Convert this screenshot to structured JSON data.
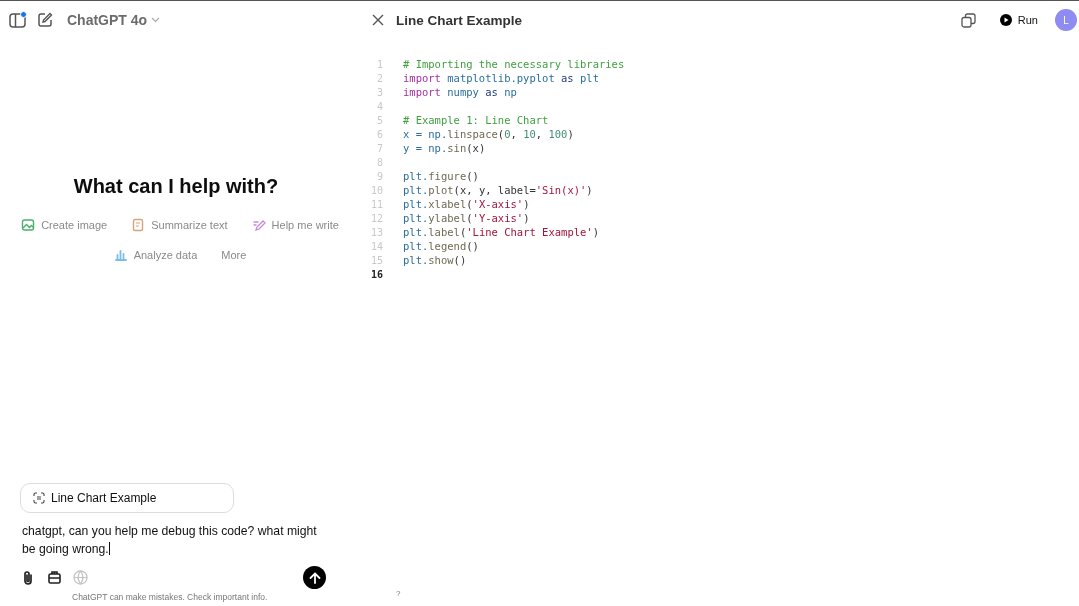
{
  "chat": {
    "model": "ChatGPT 4o",
    "sidebar_notification": true,
    "heading": "What can I help with?",
    "suggestion_rows": [
      [
        {
          "label": "Create image",
          "kind": "image",
          "color": "#4caf6a"
        },
        {
          "label": "Summarize text",
          "kind": "doc",
          "color": "#d9a27a"
        },
        {
          "label": "Help me write",
          "kind": "pen",
          "color": "#c58ad6"
        }
      ],
      [
        {
          "label": "Analyze data",
          "kind": "chart",
          "color": "#7cbde8"
        },
        {
          "label": "More",
          "kind": "none"
        }
      ]
    ],
    "attachment": {
      "label": "Line Chart Example"
    },
    "message": "chatgpt, can you help me debug this code? what might be going wrong.",
    "tools": [
      {
        "kind": "attach",
        "disabled": false
      },
      {
        "kind": "toolbox",
        "disabled": false
      },
      {
        "kind": "globe",
        "disabled": true
      }
    ],
    "footer": "ChatGPT can make mistakes. Check important info.",
    "help": "?"
  },
  "canvas": {
    "title": "Line Chart Example",
    "run_label": "Run",
    "avatar": "L",
    "lines": [
      {
        "number": "1",
        "current": false,
        "tokens": [
          {
            "text": "# Importing the necessary libraries",
            "kind": "comment"
          }
        ]
      },
      {
        "number": "2",
        "current": false,
        "tokens": [
          {
            "text": "import",
            "kind": "keyword"
          },
          {
            "text": " matplotlib.pyplot ",
            "kind": "name"
          },
          {
            "text": "as",
            "kind": "op"
          },
          {
            "text": " plt",
            "kind": "name"
          }
        ]
      },
      {
        "number": "3",
        "current": false,
        "tokens": [
          {
            "text": "import",
            "kind": "keyword"
          },
          {
            "text": " numpy ",
            "kind": "name"
          },
          {
            "text": "as",
            "kind": "op"
          },
          {
            "text": " np",
            "kind": "name"
          }
        ]
      },
      {
        "number": "4",
        "current": false
      },
      {
        "number": "5",
        "current": false,
        "tokens": [
          {
            "text": "# Example 1: Line Chart",
            "kind": "comment"
          }
        ]
      },
      {
        "number": "6",
        "current": false,
        "tokens": [
          {
            "text": "x = np.",
            "kind": "name"
          },
          {
            "text": "linspace",
            "kind": "func"
          },
          {
            "text": "(",
            "kind": "punct"
          },
          {
            "text": "0",
            "kind": "number"
          },
          {
            "text": ", ",
            "kind": "punct"
          },
          {
            "text": "10",
            "kind": "number"
          },
          {
            "text": ", ",
            "kind": "punct"
          },
          {
            "text": "100",
            "kind": "number"
          },
          {
            "text": ")",
            "kind": "punct"
          }
        ]
      },
      {
        "number": "7",
        "current": false,
        "tokens": [
          {
            "text": "y = np.",
            "kind": "name"
          },
          {
            "text": "sin",
            "kind": "func"
          },
          {
            "text": "(x)",
            "kind": "punct"
          }
        ]
      },
      {
        "number": "8",
        "current": false
      },
      {
        "number": "9",
        "current": false,
        "tokens": [
          {
            "text": "plt.",
            "kind": "name"
          },
          {
            "text": "figure",
            "kind": "func"
          },
          {
            "text": "()",
            "kind": "punct"
          }
        ]
      },
      {
        "number": "10",
        "current": false,
        "tokens": [
          {
            "text": "plt.",
            "kind": "name"
          },
          {
            "text": "plot",
            "kind": "func"
          },
          {
            "text": "(x, y, label=",
            "kind": "punct"
          },
          {
            "text": "'Sin(x)'",
            "kind": "string"
          },
          {
            "text": ")",
            "kind": "punct"
          }
        ]
      },
      {
        "number": "11",
        "current": false,
        "tokens": [
          {
            "text": "plt.",
            "kind": "name"
          },
          {
            "text": "xlabel",
            "kind": "func"
          },
          {
            "text": "(",
            "kind": "punct"
          },
          {
            "text": "'X-axis'",
            "kind": "string"
          },
          {
            "text": ")",
            "kind": "punct"
          }
        ]
      },
      {
        "number": "12",
        "current": false,
        "tokens": [
          {
            "text": "plt.",
            "kind": "name"
          },
          {
            "text": "ylabel",
            "kind": "func"
          },
          {
            "text": "(",
            "kind": "punct"
          },
          {
            "text": "'Y-axis'",
            "kind": "string"
          },
          {
            "text": ")",
            "kind": "punct"
          }
        ]
      },
      {
        "number": "13",
        "current": false,
        "tokens": [
          {
            "text": "plt.",
            "kind": "name"
          },
          {
            "text": "label",
            "kind": "func"
          },
          {
            "text": "(",
            "kind": "punct"
          },
          {
            "text": "'Line Chart Example'",
            "kind": "string"
          },
          {
            "text": ")",
            "kind": "punct"
          }
        ]
      },
      {
        "number": "14",
        "current": false,
        "tokens": [
          {
            "text": "plt.",
            "kind": "name"
          },
          {
            "text": "legend",
            "kind": "func"
          },
          {
            "text": "()",
            "kind": "punct"
          }
        ]
      },
      {
        "number": "15",
        "current": false,
        "tokens": [
          {
            "text": "plt.",
            "kind": "name"
          },
          {
            "text": "show",
            "kind": "func"
          },
          {
            "text": "()",
            "kind": "punct"
          }
        ]
      },
      {
        "number": "16",
        "current": true
      }
    ]
  }
}
